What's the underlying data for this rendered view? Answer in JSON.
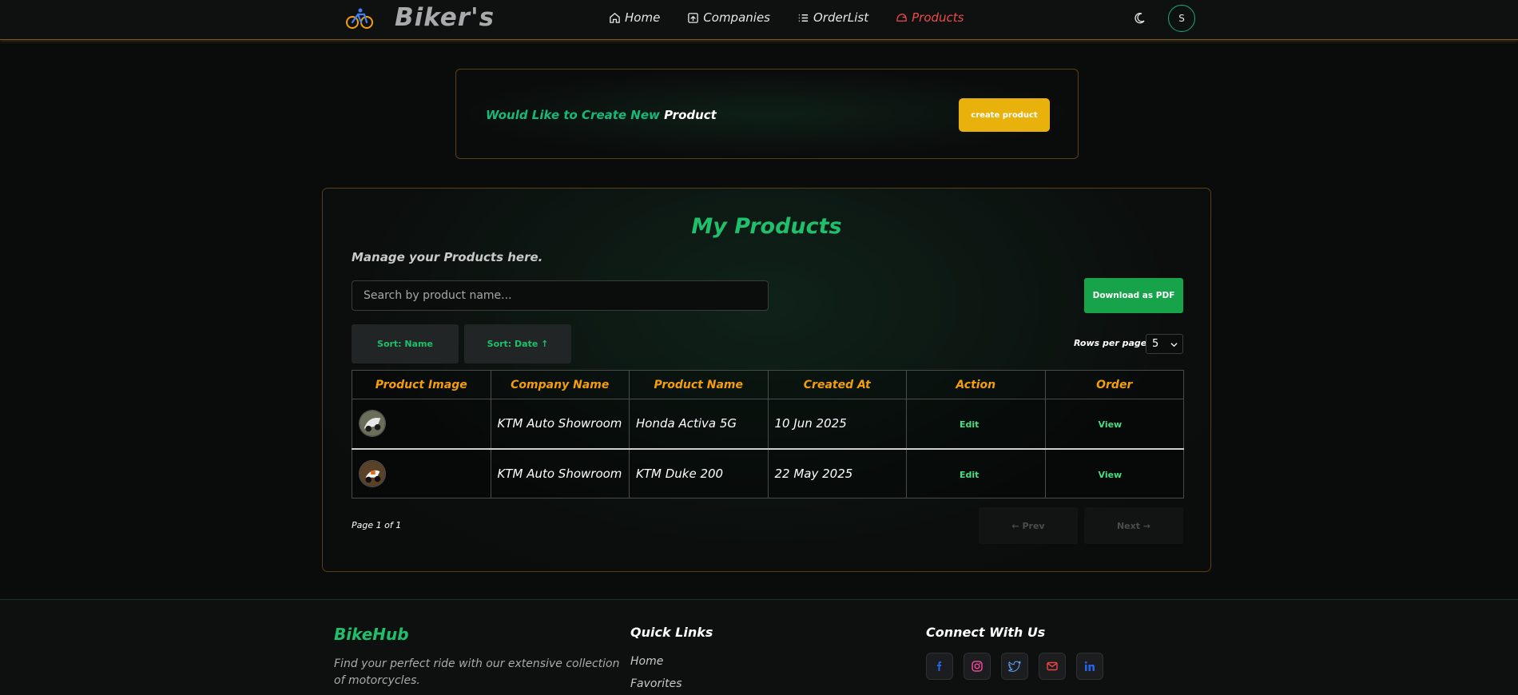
{
  "header": {
    "brand": "Biker's",
    "nav": [
      {
        "label": "Home"
      },
      {
        "label": "Companies"
      },
      {
        "label": "OrderList"
      },
      {
        "label": "Products"
      }
    ],
    "avatar_initial": "S"
  },
  "cta": {
    "text_green": "Would Like to Create New",
    "text_white": "Product",
    "button_label": "create product"
  },
  "products": {
    "title": "My Products",
    "subtitle": "Manage your Products here.",
    "search_placeholder": "Search by product name...",
    "download_label": "Download as PDF",
    "sort_name_label": "Sort: Name",
    "sort_date_label": "Sort: Date ↑",
    "rows_per_page_label": "Rows per page:",
    "rows_per_page_value": "5",
    "columns": [
      "Product Image",
      "Company Name",
      "Product Name",
      "Created At",
      "Action",
      "Order"
    ],
    "rows": [
      {
        "company": "KTM Auto Showroom",
        "product": "Honda Activa 5G",
        "created": "10 Jun 2025",
        "action": "Edit",
        "order": "View"
      },
      {
        "company": "KTM Auto Showroom",
        "product": "KTM Duke 200",
        "created": "22 May 2025",
        "action": "Edit",
        "order": "View"
      }
    ],
    "page_info": "Page 1 of 1",
    "prev_label": "← Prev",
    "next_label": "Next →"
  },
  "footer": {
    "brand": "BikeHub",
    "description": "Find your perfect ride with our extensive collection of motorcycles.",
    "quick_links_title": "Quick Links",
    "quick_links": [
      "Home",
      "Favorites"
    ],
    "connect_title": "Connect With Us",
    "social": [
      "facebook-icon",
      "instagram-icon",
      "twitter-icon",
      "mail-icon",
      "linkedin-icon"
    ]
  },
  "colors": {
    "accent_green": "#1fbf6b",
    "header_accent": "#f59e0b",
    "cta_button": "#e9b10b",
    "active_nav": "#ef4a4a"
  }
}
